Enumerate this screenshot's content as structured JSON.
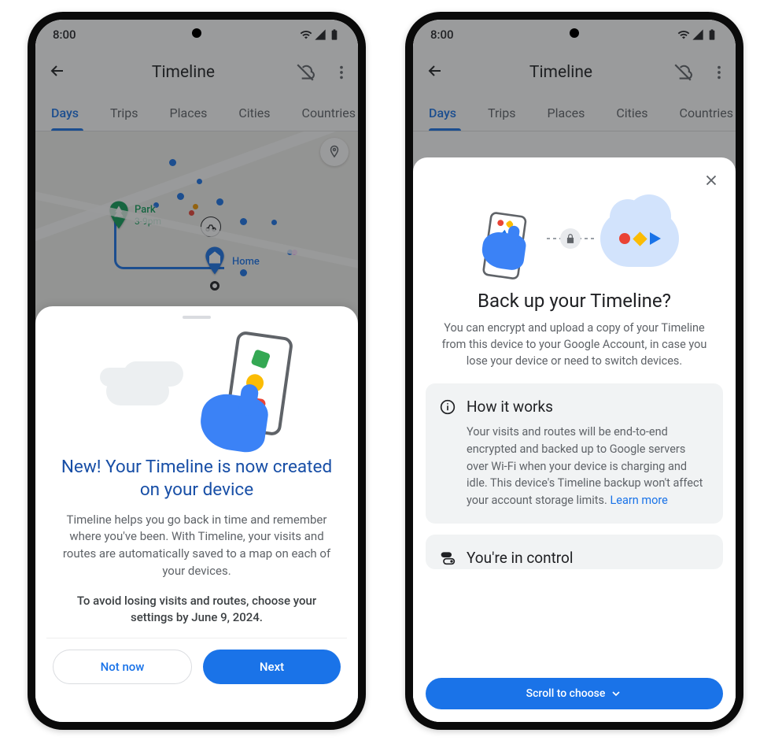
{
  "statusbar": {
    "time": "8:00"
  },
  "app": {
    "title": "Timeline",
    "tabs": [
      "Days",
      "Trips",
      "Places",
      "Cities",
      "Countries"
    ],
    "active_tab": 0,
    "map": {
      "park_label": "Park",
      "park_hours": "3-9pm",
      "home_label": "Home"
    }
  },
  "sheet1": {
    "heading": "New! Your Timeline is now created on your device",
    "body": "Timeline helps you go back in time and remember where you've been.  With Timeline, your visits and routes are automatically saved to a map on each of your devices.",
    "note": "To avoid losing visits and routes, choose your settings by June 9, 2024.",
    "not_now": "Not now",
    "next": "Next"
  },
  "sheet2": {
    "heading": "Back up your Timeline?",
    "body": "You can encrypt and upload a copy of your Timeline from this device to your Google Account, in case you lose your device or need to switch devices.",
    "card1_title": "How it works",
    "card1_body": "Your visits and routes will be end-to-end encrypted and backed up to Google servers over Wi-Fi when your device is charging and idle. This device's Timeline backup won't affect your account storage limits. ",
    "card1_link": "Learn more",
    "card2_title": "You're in control",
    "cta": "Scroll to choose"
  }
}
